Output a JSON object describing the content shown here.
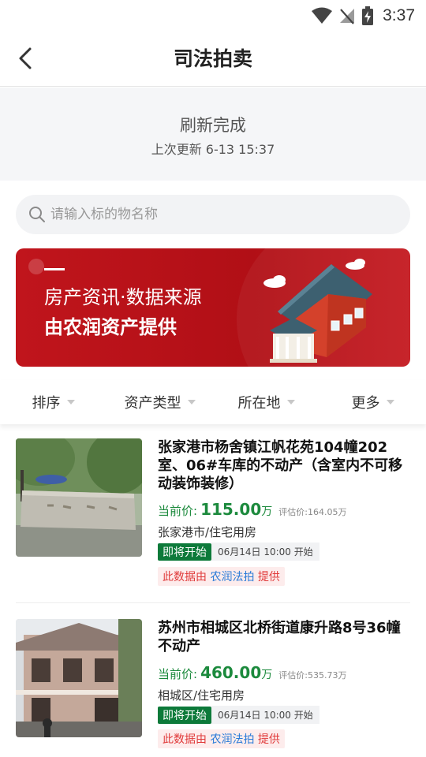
{
  "status_bar": {
    "time": "3:37"
  },
  "nav": {
    "title": "司法拍卖"
  },
  "refresh": {
    "title": "刷新完成",
    "last_update": "上次更新 6-13 15:37"
  },
  "search": {
    "placeholder": "请输入标的物名称"
  },
  "banner": {
    "line1": "房产资讯·数据来源",
    "line2": "由农润资产提供"
  },
  "filters": [
    {
      "label": "排序"
    },
    {
      "label": "资产类型"
    },
    {
      "label": "所在地"
    },
    {
      "label": "更多"
    }
  ],
  "items": [
    {
      "title": "张家港市杨舍镇江帆花苑104幢202室、06#车库的不动产（含室内不可移动装饰装修）",
      "price_label": "当前价:",
      "price": "115.00",
      "price_unit": "万",
      "est_label": "评估价:",
      "est_value": "164.05万",
      "place": "张家港市/住宅用房",
      "status": "即将开始",
      "start_time": "06月14日 10:00 开始",
      "source_prefix": "此数据由",
      "source_name": "农润法拍",
      "source_suffix": "提供"
    },
    {
      "title": "苏州市相城区北桥街道康升路8号36幢不动产",
      "price_label": "当前价:",
      "price": "460.00",
      "price_unit": "万",
      "est_label": "评估价:",
      "est_value": "535.73万",
      "place": "相城区/住宅用房",
      "status": "即将开始",
      "start_time": "06月14日 10:00 开始",
      "source_prefix": "此数据由",
      "source_name": "农润法拍",
      "source_suffix": "提供"
    }
  ],
  "colors": {
    "accent_green": "#1c8a3d",
    "banner_red": "#b10f16",
    "badge_green": "#0d7a3a"
  },
  "icons": [
    "wifi-icon",
    "no-signal-icon",
    "battery-charging-icon",
    "back-icon",
    "search-icon",
    "house-icon"
  ]
}
